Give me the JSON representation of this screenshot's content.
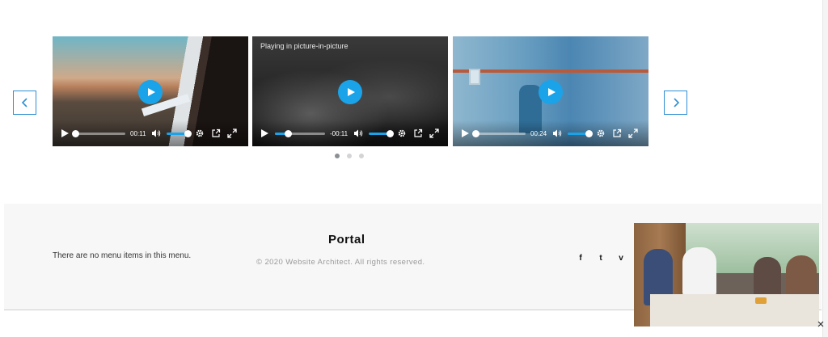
{
  "carousel": {
    "prev_label": "",
    "next_label": "",
    "videos": [
      {
        "time": "00:11",
        "progress": 0.0,
        "overlay_text": "",
        "volume": 1.0
      },
      {
        "time": "-00:11",
        "progress": 0.25,
        "overlay_text": "Playing in picture-in-picture",
        "volume": 1.0
      },
      {
        "time": "00:24",
        "progress": 0.0,
        "overlay_text": "",
        "volume": 1.0
      }
    ],
    "pagination": {
      "count": 3,
      "active_index": 0
    }
  },
  "footer": {
    "menu_empty_text": "There are no menu items in this menu.",
    "title": "Portal",
    "copyright": "© 2020 Website Architect. All rights reserved.",
    "social": [
      {
        "name": "facebook-icon",
        "glyph": "f"
      },
      {
        "name": "twitter-icon",
        "glyph": "t"
      },
      {
        "name": "vimeo-icon",
        "glyph": "v"
      }
    ]
  },
  "pip_window": {
    "close_glyph": "×"
  },
  "colors": {
    "accent": "#1aa3e8",
    "nav_border": "#2f8fd3",
    "footer_bg": "#f7f7f7",
    "copyright_text": "#9a9a9a",
    "dot_active": "#8a8f94",
    "dot_inactive": "#d4d4d4"
  }
}
